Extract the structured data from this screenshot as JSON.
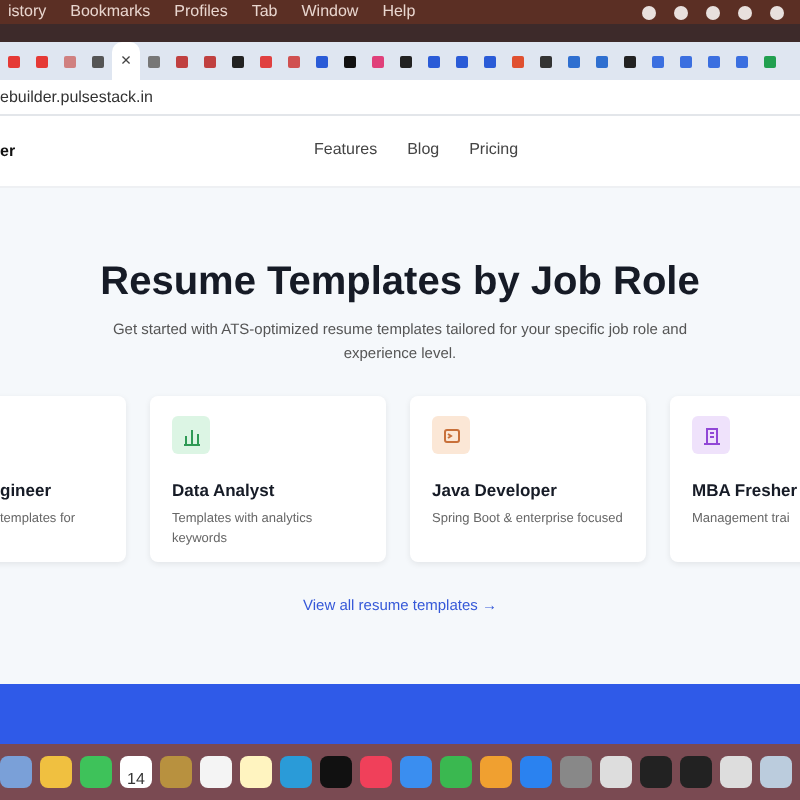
{
  "menu_bar": {
    "items": [
      "istory",
      "Bookmarks",
      "Profiles",
      "Tab",
      "Window",
      "Help"
    ]
  },
  "tabs": [
    {
      "selected": false
    },
    {
      "selected": false
    },
    {
      "selected": false
    },
    {
      "selected": false
    },
    {
      "selected": true,
      "close": "×"
    },
    {
      "selected": false
    },
    {
      "selected": false
    },
    {
      "selected": false
    },
    {
      "selected": false
    },
    {
      "selected": false
    },
    {
      "selected": false
    },
    {
      "selected": false
    },
    {
      "selected": false
    },
    {
      "selected": false
    },
    {
      "selected": false
    },
    {
      "selected": false
    },
    {
      "selected": false
    },
    {
      "selected": false
    },
    {
      "selected": false
    },
    {
      "selected": false
    },
    {
      "selected": false
    },
    {
      "selected": false
    },
    {
      "selected": false
    },
    {
      "selected": false
    },
    {
      "selected": false
    },
    {
      "selected": false
    },
    {
      "selected": false
    },
    {
      "selected": false
    }
  ],
  "address_bar": {
    "url": "ebuilder.pulsestack.in"
  },
  "site_nav": {
    "logo": "er",
    "links": [
      "Features",
      "Blog",
      "Pricing"
    ]
  },
  "hero": {
    "title": "Resume Templates by Job Role",
    "subtitle": "Get started with ATS-optimized resume templates tailored for your specific job role and experience level."
  },
  "cards": [
    {
      "kind": "none",
      "title": "gineer",
      "description": "templates for"
    },
    {
      "kind": "chart",
      "title": "Data Analyst",
      "description": "Templates with analytics keywords"
    },
    {
      "kind": "terminal",
      "title": "Java Developer",
      "description": "Spring Boot & enterprise focused"
    },
    {
      "kind": "building",
      "title": "MBA Fresher",
      "description": "Management trai"
    }
  ],
  "view_all_link": "View all resume templates →",
  "dock": {
    "calendar_day": "14"
  }
}
